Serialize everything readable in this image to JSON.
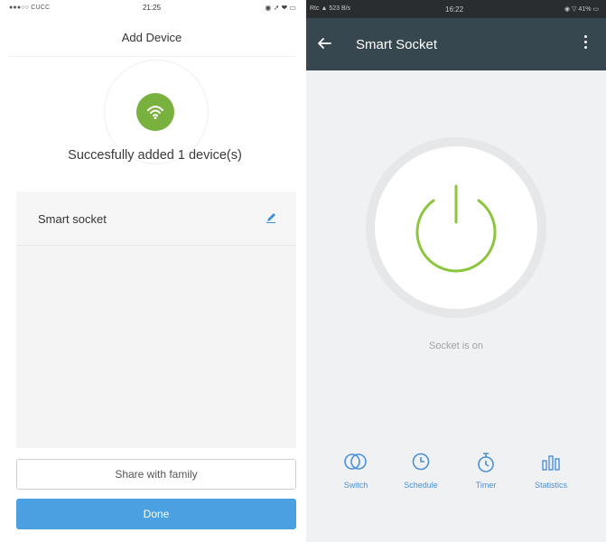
{
  "left_phone": {
    "status": {
      "carrier": "●●●○○ CUCC",
      "time": "21:25",
      "icons": "◉ ➚ ❤ ▭"
    },
    "title": "Add Device",
    "success_message": "Succesfully added 1 device(s)",
    "device_row": {
      "name": "Smart socket"
    },
    "share_button": "Share with family",
    "done_button": "Done",
    "colors": {
      "accent_green": "#79b13f",
      "done_blue": "#4aa0e0"
    }
  },
  "right_phone": {
    "status": {
      "left": "Rtc ▲ 523 B/s",
      "time": "16:22",
      "right": "◉ ▽ 41% ▭"
    },
    "title": "Smart Socket",
    "state_text": "Socket is on",
    "nav": [
      {
        "label": "Switch",
        "icon": "switch-icon"
      },
      {
        "label": "Schedule",
        "icon": "clock-icon"
      },
      {
        "label": "Timer",
        "icon": "stopwatch-icon"
      },
      {
        "label": "Statistics",
        "icon": "bar-chart-icon"
      }
    ],
    "colors": {
      "appbar": "#37474f",
      "power_green": "#8cc63f",
      "nav_blue": "#4a90d9"
    }
  }
}
